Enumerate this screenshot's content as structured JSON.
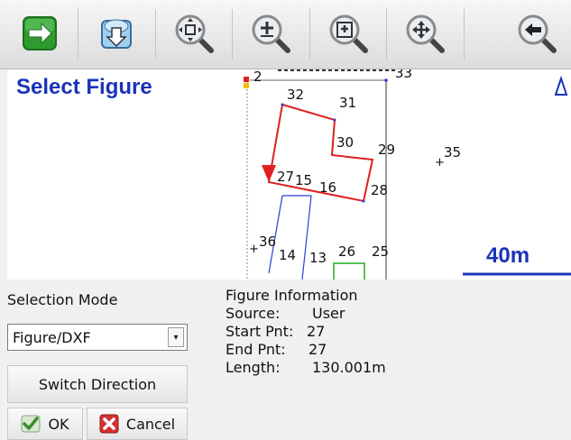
{
  "map": {
    "title": "Select Figure",
    "scale_label": "40m",
    "points": [
      "2",
      "33",
      "32",
      "31",
      "30",
      "29",
      "35",
      "27",
      "15",
      "16",
      "28",
      "36",
      "14",
      "13",
      "26",
      "25"
    ]
  },
  "selection_mode": {
    "label": "Selection Mode",
    "value": "Figure/DXF"
  },
  "buttons": {
    "switch_direction": "Switch Direction",
    "ok": "OK",
    "cancel": "Cancel"
  },
  "figure_info": {
    "title": "Figure Information",
    "source_label": "Source:",
    "source_value": "User",
    "start_label": "Start Pnt:",
    "start_value": "27",
    "end_label": "End Pnt:",
    "end_value": "27",
    "length_label": "Length:",
    "length_value": "130.001m"
  },
  "colors": {
    "title_blue": "#1a33b8",
    "figure_red": "#e02020",
    "line_blue": "#2a3fd0",
    "line_green": "#22aa22"
  }
}
